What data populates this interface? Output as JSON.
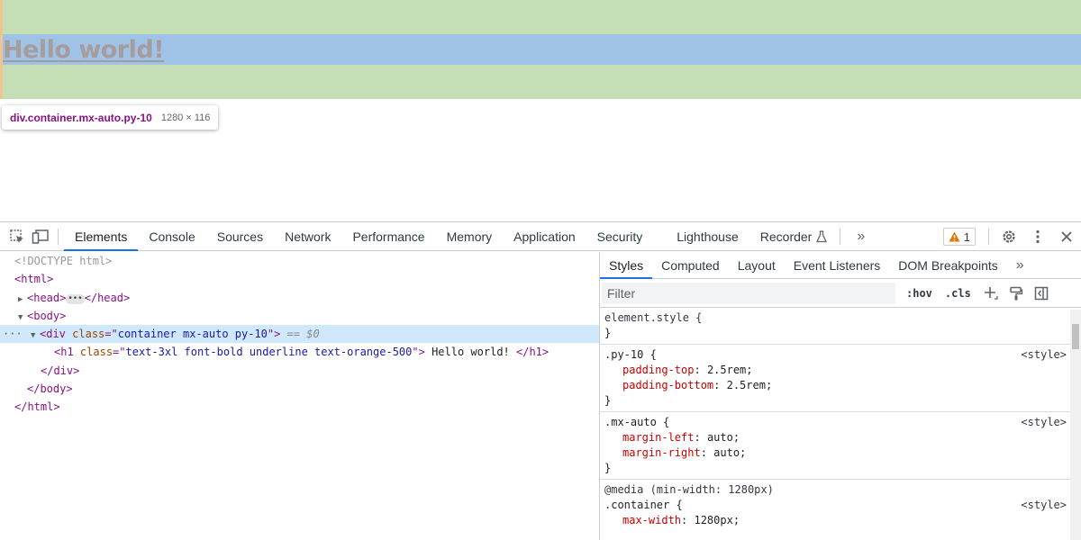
{
  "page": {
    "heading": "Hello world!",
    "tooltip": {
      "selector": "div.container.mx-auto.py-10",
      "size": "1280 × 116"
    }
  },
  "devtools": {
    "tabs": [
      "Elements",
      "Console",
      "Sources",
      "Network",
      "Performance",
      "Memory",
      "Application",
      "Security",
      "Lighthouse",
      "Recorder"
    ],
    "active_tab": "Elements",
    "more_tabs": "»",
    "warning_count": "1"
  },
  "elements": {
    "doctype": "<!DOCTYPE html>",
    "html_open": "<html>",
    "head_open": "<head>",
    "head_close": "</head>",
    "body_open": "<body>",
    "div_tag": "div",
    "div_class_attr": "class",
    "div_class_val": "container mx-auto py-10",
    "selected_marker": "== $0",
    "h1_tag": "h1",
    "h1_class_val": "text-3xl font-bold underline text-orange-500",
    "h1_text": " Hello world! ",
    "div_close": "</div>",
    "body_close": "</body>",
    "html_close": "</html>"
  },
  "styles": {
    "tabs": [
      "Styles",
      "Computed",
      "Layout",
      "Event Listeners",
      "DOM Breakpoints"
    ],
    "active_tab": "Styles",
    "more": "»",
    "filter_placeholder": "Filter",
    "hov": ":hov",
    "cls": ".cls",
    "rules": {
      "element": {
        "selector": "element.style {",
        "close": "}"
      },
      "py10": {
        "selector": ".py-10 {",
        "source": "<style>",
        "p1_name": "padding-top",
        "p1_val": "2.5rem;",
        "p2_name": "padding-bottom",
        "p2_val": "2.5rem;",
        "close": "}"
      },
      "mxauto": {
        "selector": ".mx-auto {",
        "source": "<style>",
        "p1_name": "margin-left",
        "p1_val": "auto;",
        "p2_name": "margin-right",
        "p2_val": "auto;",
        "close": "}"
      },
      "container": {
        "media": "@media (min-width: 1280px)",
        "selector": ".container {",
        "source": "<style>",
        "p1_name": "max-width",
        "p1_val": "1280px;"
      }
    }
  },
  "colors": {
    "padding_overlay": "#c6deb6",
    "content_overlay": "#9fc3e7",
    "margin_overlay": "#f0c48f",
    "accent": "#1a73e8"
  }
}
